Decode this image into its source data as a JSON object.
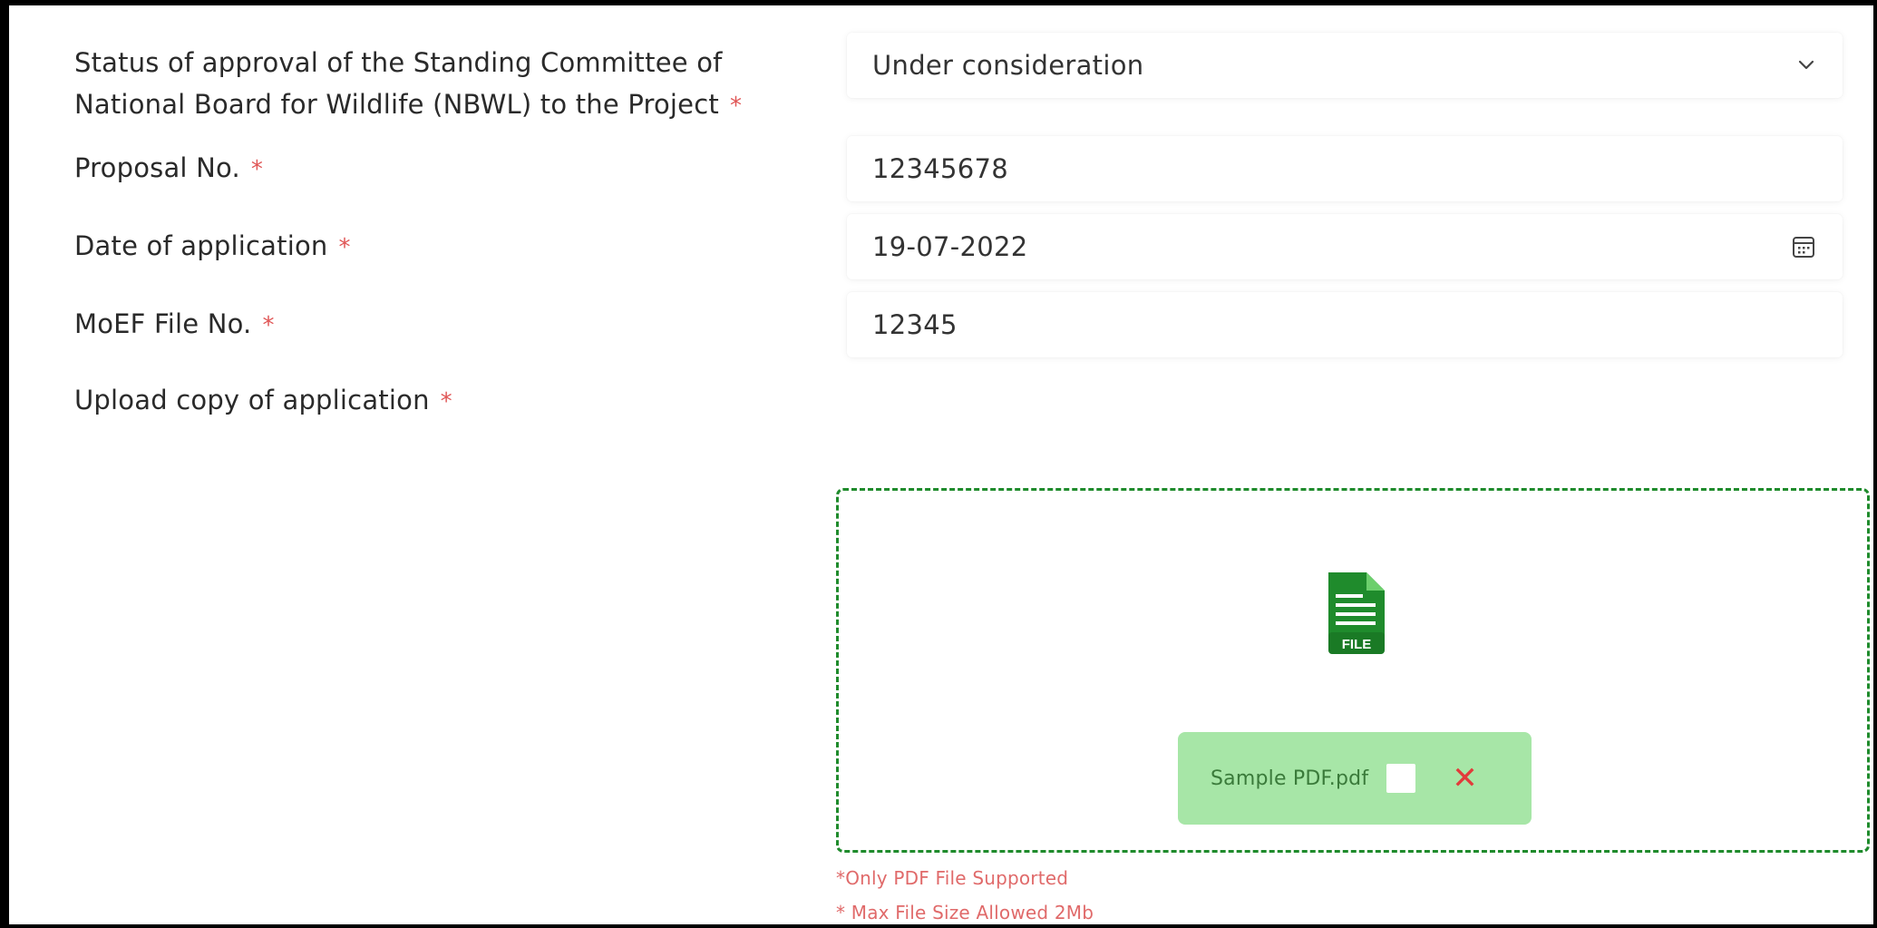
{
  "form": {
    "nbwl_status": {
      "label_line1": "Status of approval of the Standing Committee of",
      "label_line2": "National Board for Wildlife (NBWL) to the Project",
      "required_mark": "*",
      "selected_value": "Under consideration",
      "icon": "chevron-down-icon"
    },
    "proposal_no": {
      "label": "Proposal No.",
      "required_mark": "*",
      "value": "12345678"
    },
    "date_of_application": {
      "label": "Date of application",
      "required_mark": "*",
      "value": "19-07-2022",
      "icon": "calendar-icon"
    },
    "moef_file_no": {
      "label": "MoEF File No.",
      "required_mark": "*",
      "value": "12345"
    },
    "upload_application": {
      "label": "Upload copy of application",
      "required_mark": "*",
      "icon": "file-icon",
      "icon_text": "FILE",
      "uploaded_file": "Sample PDF.pdf",
      "remove_symbol": "✕",
      "hint_pdf_only": "*Only PDF File Supported",
      "hint_max_size": "* Max File Size Allowed 2Mb"
    }
  },
  "colors": {
    "accent_green": "#1f8b2c",
    "chip_bg": "#a7e6a7",
    "required_red": "#e05656",
    "remove_red": "#e23b3b"
  }
}
